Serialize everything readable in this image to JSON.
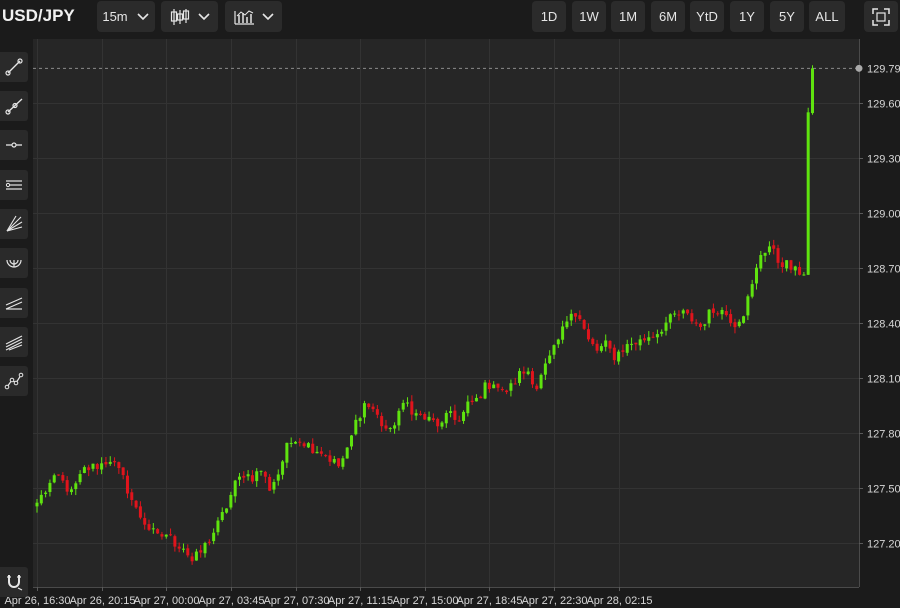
{
  "toolbar": {
    "symbol": "USD/JPY",
    "interval": "15m",
    "ranges": [
      "1D",
      "1W",
      "1M",
      "6M",
      "YtD",
      "1Y",
      "5Y",
      "ALL"
    ],
    "chart_type_icon": "candlestick-icon",
    "indicator_icon": "indicators-icon",
    "fullscreen_icon": "fullscreen-icon"
  },
  "sidebar": {
    "tools": [
      {
        "icon": "trend-line-icon"
      },
      {
        "icon": "ray-line-icon"
      },
      {
        "icon": "horizontal-line-icon"
      },
      {
        "icon": "parallel-channel-icon"
      },
      {
        "icon": "fan-lines-icon"
      },
      {
        "icon": "arc-icon"
      },
      {
        "icon": "regression-channel-icon"
      },
      {
        "icon": "pitchfork-icon"
      },
      {
        "icon": "path-icon"
      }
    ],
    "magnet_icon": "magnet-icon"
  },
  "colors": {
    "up": "#5fe30f",
    "down": "#e0141c",
    "background": "#262626",
    "grid": "#333333",
    "axis_text": "#d6d6d6"
  },
  "chart_data": {
    "type": "candlestick",
    "instrument": "USD/JPY",
    "interval": "15m",
    "ylim": [
      126.96,
      129.95
    ],
    "y_ticks": [
      "127.20",
      "127.50",
      "127.80",
      "128.10",
      "128.40",
      "128.70",
      "129.00",
      "129.30",
      "129.60"
    ],
    "x_ticks": [
      "Apr 26, 16:30",
      "Apr 26, 20:15",
      "Apr 27, 00:00",
      "Apr 27, 03:45",
      "Apr 27, 07:30",
      "Apr 27, 11:15",
      "Apr 27, 15:00",
      "Apr 27, 18:45",
      "Apr 27, 22:30",
      "Apr 28, 02:15"
    ],
    "last_price": "129.79",
    "grid": true,
    "anchors": [
      [
        0,
        127.42
      ],
      [
        3,
        127.52
      ],
      [
        5,
        127.56
      ],
      [
        8,
        127.47
      ],
      [
        11,
        127.6
      ],
      [
        15,
        127.63
      ],
      [
        17,
        127.66
      ],
      [
        20,
        127.55
      ],
      [
        23,
        127.38
      ],
      [
        26,
        127.28
      ],
      [
        28,
        127.23
      ],
      [
        30,
        127.25
      ],
      [
        32,
        127.2
      ],
      [
        34,
        127.18
      ],
      [
        36,
        127.1
      ],
      [
        38,
        127.15
      ],
      [
        40,
        127.22
      ],
      [
        42,
        127.3
      ],
      [
        44,
        127.4
      ],
      [
        46,
        127.52
      ],
      [
        48,
        127.58
      ],
      [
        50,
        127.56
      ],
      [
        52,
        127.6
      ],
      [
        54,
        127.5
      ],
      [
        56,
        127.58
      ],
      [
        58,
        127.72
      ],
      [
        60,
        127.78
      ],
      [
        62,
        127.75
      ],
      [
        64,
        127.72
      ],
      [
        66,
        127.7
      ],
      [
        68,
        127.66
      ],
      [
        70,
        127.62
      ],
      [
        72,
        127.7
      ],
      [
        74,
        127.86
      ],
      [
        76,
        127.96
      ],
      [
        78,
        127.93
      ],
      [
        80,
        127.85
      ],
      [
        82,
        127.8
      ],
      [
        84,
        127.92
      ],
      [
        86,
        127.96
      ],
      [
        88,
        127.9
      ],
      [
        90,
        127.88
      ],
      [
        92,
        127.86
      ],
      [
        94,
        127.84
      ],
      [
        96,
        127.92
      ],
      [
        98,
        127.86
      ],
      [
        100,
        127.95
      ],
      [
        102,
        127.98
      ],
      [
        104,
        128.05
      ],
      [
        106,
        128.08
      ],
      [
        108,
        128.02
      ],
      [
        110,
        128.05
      ],
      [
        112,
        128.12
      ],
      [
        114,
        128.14
      ],
      [
        116,
        128.05
      ],
      [
        118,
        128.16
      ],
      [
        120,
        128.25
      ],
      [
        122,
        128.36
      ],
      [
        124,
        128.48
      ],
      [
        126,
        128.42
      ],
      [
        128,
        128.3
      ],
      [
        130,
        128.25
      ],
      [
        132,
        128.28
      ],
      [
        134,
        128.22
      ],
      [
        136,
        128.26
      ],
      [
        138,
        128.29
      ],
      [
        140,
        128.3
      ],
      [
        142,
        128.33
      ],
      [
        144,
        128.35
      ],
      [
        146,
        128.4
      ],
      [
        148,
        128.44
      ],
      [
        150,
        128.45
      ],
      [
        152,
        128.42
      ],
      [
        154,
        128.38
      ],
      [
        156,
        128.45
      ],
      [
        158,
        128.48
      ],
      [
        160,
        128.45
      ],
      [
        162,
        128.4
      ],
      [
        164,
        128.46
      ],
      [
        166,
        128.6
      ],
      [
        168,
        128.78
      ],
      [
        170,
        128.82
      ],
      [
        172,
        128.74
      ],
      [
        174,
        128.72
      ],
      [
        176,
        128.68
      ],
      [
        178,
        128.68
      ],
      [
        179,
        129.55
      ],
      [
        180,
        129.79
      ]
    ]
  }
}
